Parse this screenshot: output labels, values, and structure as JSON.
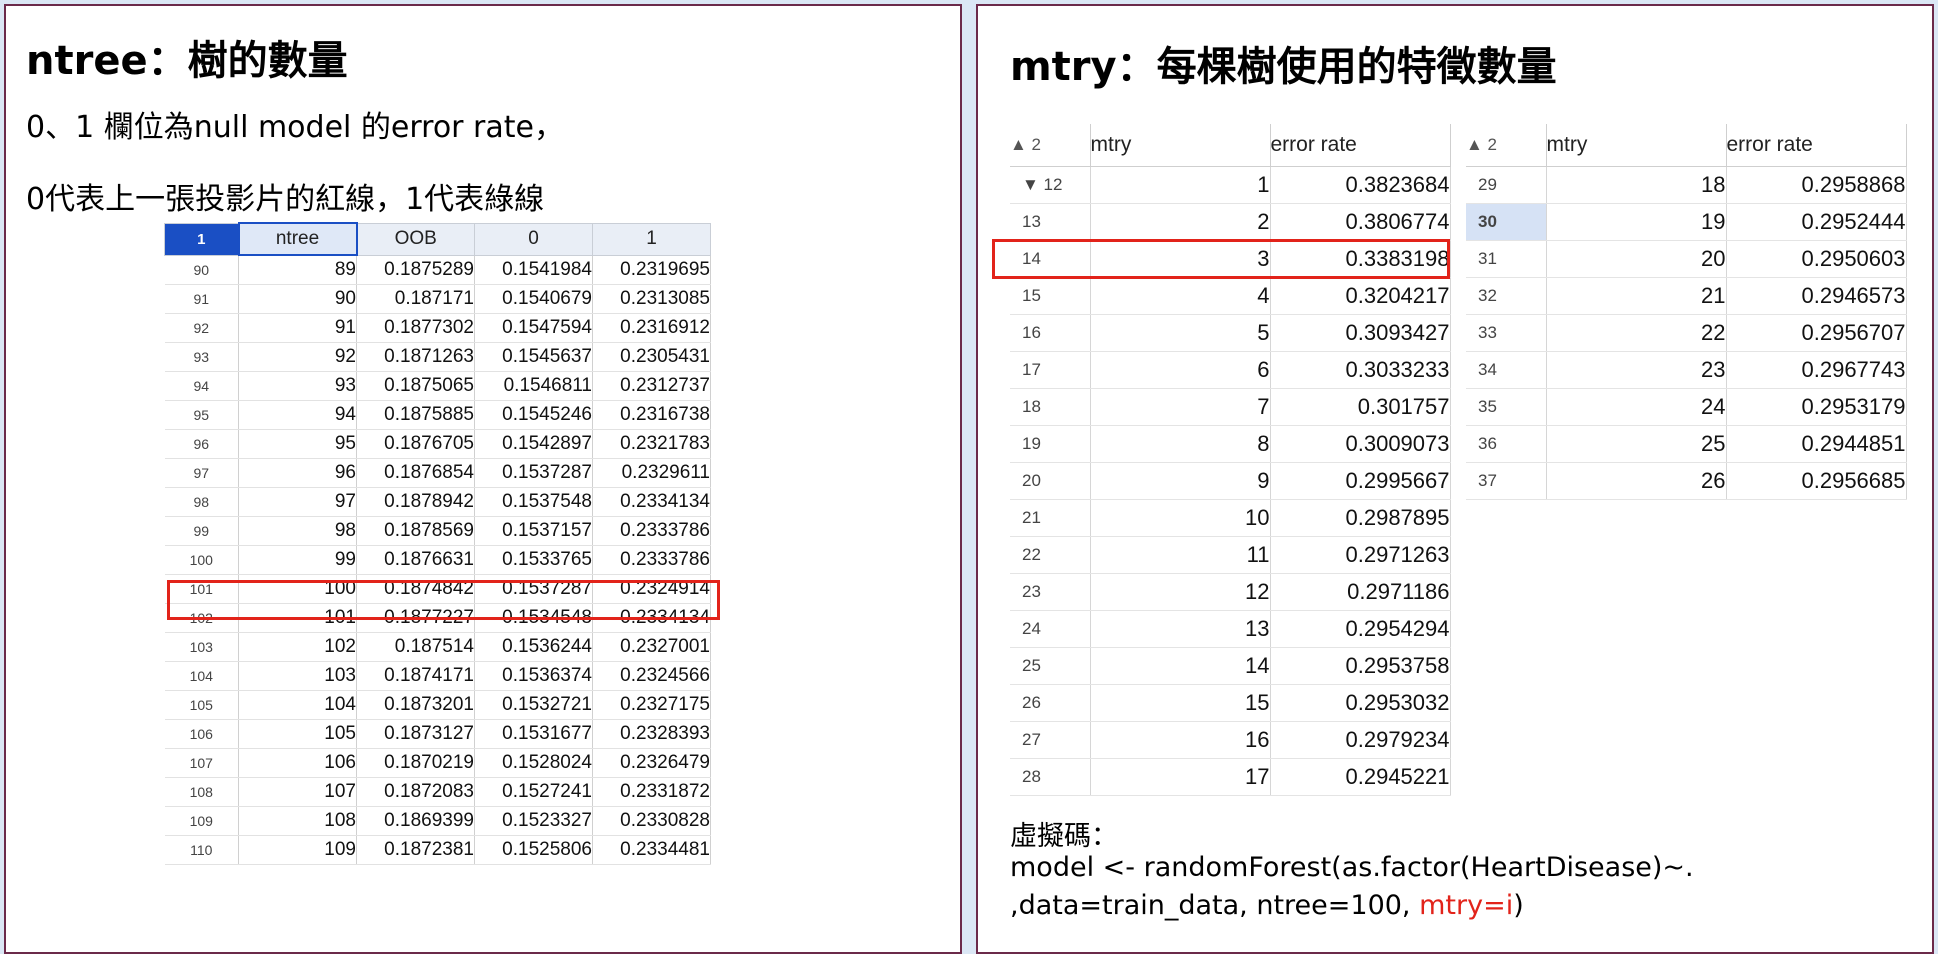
{
  "left": {
    "title": "ntree：樹的數量",
    "line1": "0、1 欄位為null model 的error rate，",
    "line2": "0代表上一張投影片的紅線，1代表綠線",
    "table": {
      "corner": "1",
      "headers": [
        "ntree",
        "OOB",
        "0",
        "1"
      ],
      "rows": [
        [
          "90",
          "89",
          "0.1875289",
          "0.1541984",
          "0.2319695"
        ],
        [
          "91",
          "90",
          "0.187171",
          "0.1540679",
          "0.2313085"
        ],
        [
          "92",
          "91",
          "0.1877302",
          "0.1547594",
          "0.2316912"
        ],
        [
          "93",
          "92",
          "0.1871263",
          "0.1545637",
          "0.2305431"
        ],
        [
          "94",
          "93",
          "0.1875065",
          "0.1546811",
          "0.2312737"
        ],
        [
          "95",
          "94",
          "0.1875885",
          "0.1545246",
          "0.2316738"
        ],
        [
          "96",
          "95",
          "0.1876705",
          "0.1542897",
          "0.2321783"
        ],
        [
          "97",
          "96",
          "0.1876854",
          "0.1537287",
          "0.2329611"
        ],
        [
          "98",
          "97",
          "0.1878942",
          "0.1537548",
          "0.2334134"
        ],
        [
          "99",
          "98",
          "0.1878569",
          "0.1537157",
          "0.2333786"
        ],
        [
          "100",
          "99",
          "0.1876631",
          "0.1533765",
          "0.2333786"
        ],
        [
          "101",
          "100",
          "0.1874842",
          "0.1537287",
          "0.2324914"
        ],
        [
          "102",
          "101",
          "0.1877227",
          "0.1534548",
          "0.2334134"
        ],
        [
          "103",
          "102",
          "0.187514",
          "0.1536244",
          "0.2327001"
        ],
        [
          "104",
          "103",
          "0.1874171",
          "0.1536374",
          "0.2324566"
        ],
        [
          "105",
          "104",
          "0.1873201",
          "0.1532721",
          "0.2327175"
        ],
        [
          "106",
          "105",
          "0.1873127",
          "0.1531677",
          "0.2328393"
        ],
        [
          "107",
          "106",
          "0.1870219",
          "0.1528024",
          "0.2326479"
        ],
        [
          "108",
          "107",
          "0.1872083",
          "0.1527241",
          "0.2331872"
        ],
        [
          "109",
          "108",
          "0.1869399",
          "0.1523327",
          "0.2330828"
        ],
        [
          "110",
          "109",
          "0.1872381",
          "0.1525806",
          "0.2334481"
        ]
      ],
      "highlight_row": "101"
    }
  },
  "right": {
    "title": "mtry：每棵樹使用的特徵數量",
    "table1": {
      "corner": "▲ 2",
      "headers": [
        "mtry",
        "error rate"
      ],
      "rows": [
        [
          "▼ 12",
          "1",
          "0.3823684"
        ],
        [
          "13",
          "2",
          "0.3806774"
        ],
        [
          "14",
          "3",
          "0.3383198"
        ],
        [
          "15",
          "4",
          "0.3204217"
        ],
        [
          "16",
          "5",
          "0.3093427"
        ],
        [
          "17",
          "6",
          "0.3033233"
        ],
        [
          "18",
          "7",
          "0.301757"
        ],
        [
          "19",
          "8",
          "0.3009073"
        ],
        [
          "20",
          "9",
          "0.2995667"
        ],
        [
          "21",
          "10",
          "0.2987895"
        ],
        [
          "22",
          "11",
          "0.2971263"
        ],
        [
          "23",
          "12",
          "0.2971186"
        ],
        [
          "24",
          "13",
          "0.2954294"
        ],
        [
          "25",
          "14",
          "0.2953758"
        ],
        [
          "26",
          "15",
          "0.2953032"
        ],
        [
          "27",
          "16",
          "0.2979234"
        ],
        [
          "28",
          "17",
          "0.2945221"
        ]
      ],
      "highlight_row": "14"
    },
    "table2": {
      "corner": "▲ 2",
      "headers": [
        "mtry",
        "error rate"
      ],
      "rows": [
        [
          "29",
          "18",
          "0.2958868"
        ],
        [
          "30",
          "19",
          "0.2952444"
        ],
        [
          "31",
          "20",
          "0.2950603"
        ],
        [
          "32",
          "21",
          "0.2946573"
        ],
        [
          "33",
          "22",
          "0.2956707"
        ],
        [
          "34",
          "23",
          "0.2967743"
        ],
        [
          "35",
          "24",
          "0.2953179"
        ],
        [
          "36",
          "25",
          "0.2944851"
        ],
        [
          "37",
          "26",
          "0.2956685"
        ]
      ],
      "selected_row": "30"
    },
    "code_label": "虛擬碼：",
    "code_line1": "model <- randomForest(as.factor(HeartDisease)~.",
    "code_line2_prefix": ",data=train_data, ntree=100, ",
    "code_line2_red": "mtry=i",
    "code_line2_suffix": ")"
  },
  "colors": {
    "highlight": "#e2231a",
    "selected_header": "#1a4fc4",
    "panel_border": "#6b2a4a",
    "background": "#dbe7f5"
  }
}
